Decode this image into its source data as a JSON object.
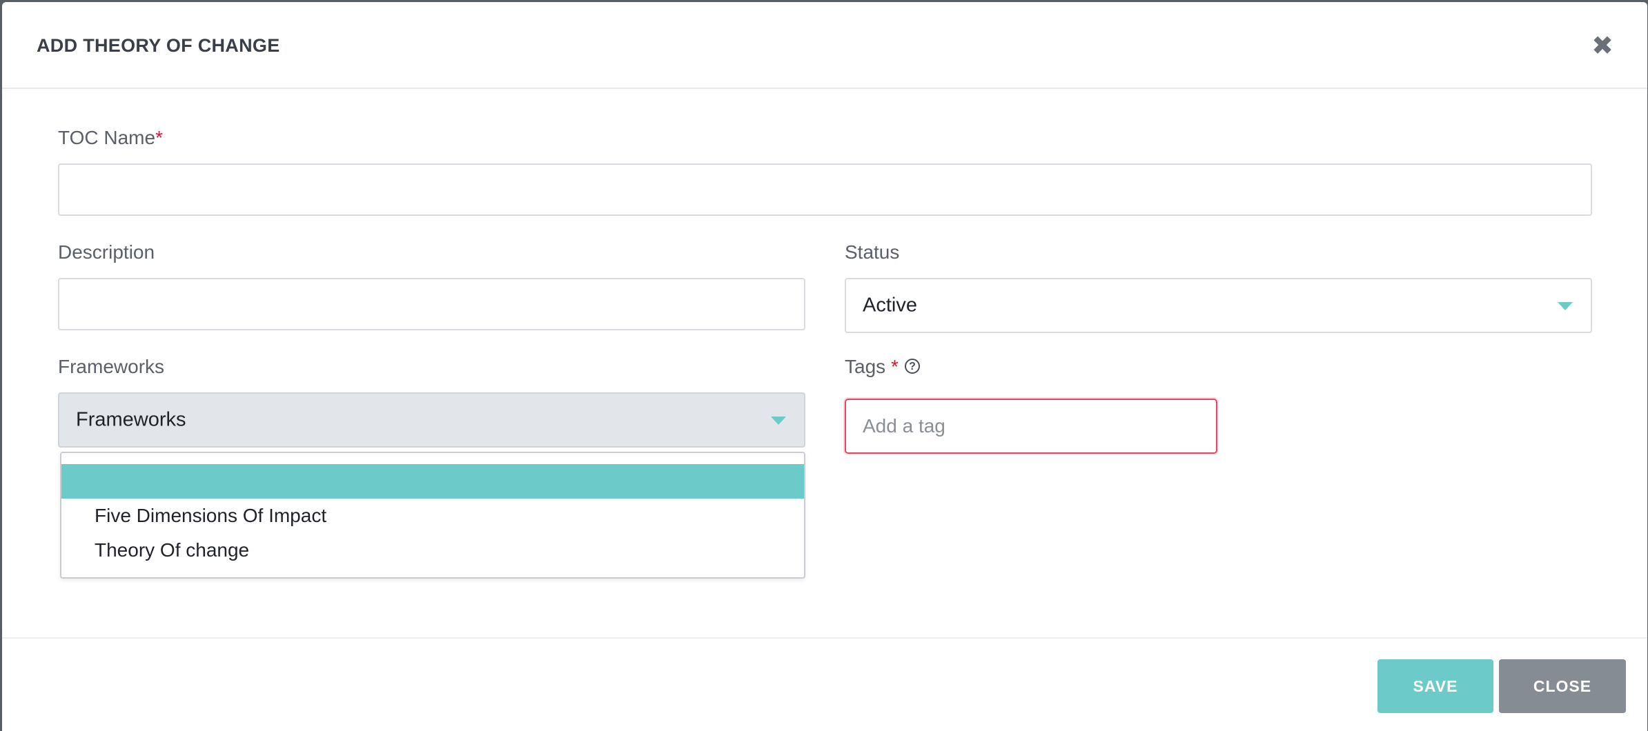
{
  "modal": {
    "title": "ADD THEORY OF CHANGE",
    "close_icon": "close-x-icon"
  },
  "form": {
    "toc_name": {
      "label": "TOC Name",
      "required_mark": "*",
      "value": ""
    },
    "description": {
      "label": "Description",
      "value": ""
    },
    "status": {
      "label": "Status",
      "selected": "Active"
    },
    "frameworks": {
      "label": "Frameworks",
      "selected": "Frameworks",
      "options": [
        "",
        "Five Dimensions Of Impact",
        "Theory Of change"
      ],
      "highlighted_index": 0
    },
    "tags": {
      "label": "Tags",
      "required_mark": "*",
      "help_icon": "question-circle-icon",
      "placeholder": "Add a tag"
    }
  },
  "footer": {
    "save_label": "SAVE",
    "close_label": "CLOSE"
  },
  "colors": {
    "accent": "#6ccbc9",
    "required": "#d01c3c",
    "error_border": "#e4485e",
    "close_button": "#868c94"
  }
}
